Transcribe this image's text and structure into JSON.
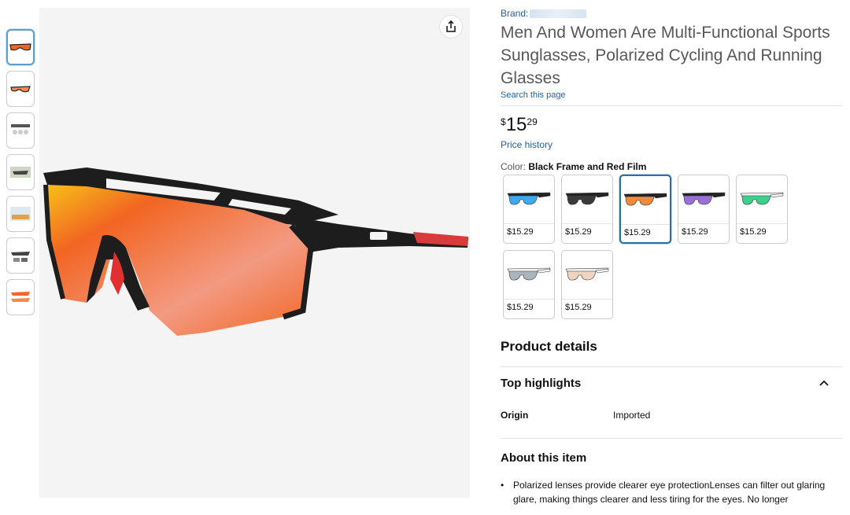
{
  "brand": {
    "label": "Brand:"
  },
  "product": {
    "title": "Men And Women Are Multi-Functional Sports Sunglasses, Polarized Cycling And Running Glasses",
    "search_page": "Search this page",
    "price": {
      "symbol": "$",
      "whole": "15",
      "fraction": "29"
    },
    "price_history": "Price history",
    "color_label": "Color:",
    "color_value": "Black Frame and Red Film"
  },
  "thumbnails": [
    {
      "icon": "sunglasses-red-thumb"
    },
    {
      "icon": "sunglasses-red-side-thumb"
    },
    {
      "icon": "feature-chart-thumb"
    },
    {
      "icon": "camo-lifestyle-thumb"
    },
    {
      "icon": "cycling-lifestyle-thumb"
    },
    {
      "icon": "accessories-set-thumb"
    },
    {
      "icon": "multi-color-thumb"
    }
  ],
  "swatches": [
    {
      "name": "blue",
      "price": "$15.29",
      "lens": "#3fa9ee",
      "frame": "#222222"
    },
    {
      "name": "black",
      "price": "$15.29",
      "lens": "#3a3a3a",
      "frame": "#222222"
    },
    {
      "name": "red",
      "price": "$15.29",
      "lens": "#f08a3a",
      "frame": "#222222",
      "selected": true
    },
    {
      "name": "purple",
      "price": "$15.29",
      "lens": "#9b6fd8",
      "frame": "#222222"
    },
    {
      "name": "green",
      "price": "$15.29",
      "lens": "#3ecf8e",
      "frame": "#f2f2f2"
    },
    {
      "name": "silver",
      "price": "$15.29",
      "lens": "#aab4bd",
      "frame": "#f2f2f2"
    },
    {
      "name": "peach",
      "price": "$15.29",
      "lens": "#f2d3bf",
      "frame": "#f2f2f2"
    }
  ],
  "details": {
    "title": "Product details",
    "highlights_title": "Top highlights",
    "origin_key": "Origin",
    "origin_value": "Imported",
    "about_title": "About this item",
    "bullet_1": "Polarized lenses provide clearer eye protectionLenses can filter out glaring glare, making things clearer and less tiring for the eyes. No longer"
  },
  "colors": {
    "link": "#2162a1",
    "selected_border": "#2f6f9a",
    "lens_orange": "#f26522"
  }
}
